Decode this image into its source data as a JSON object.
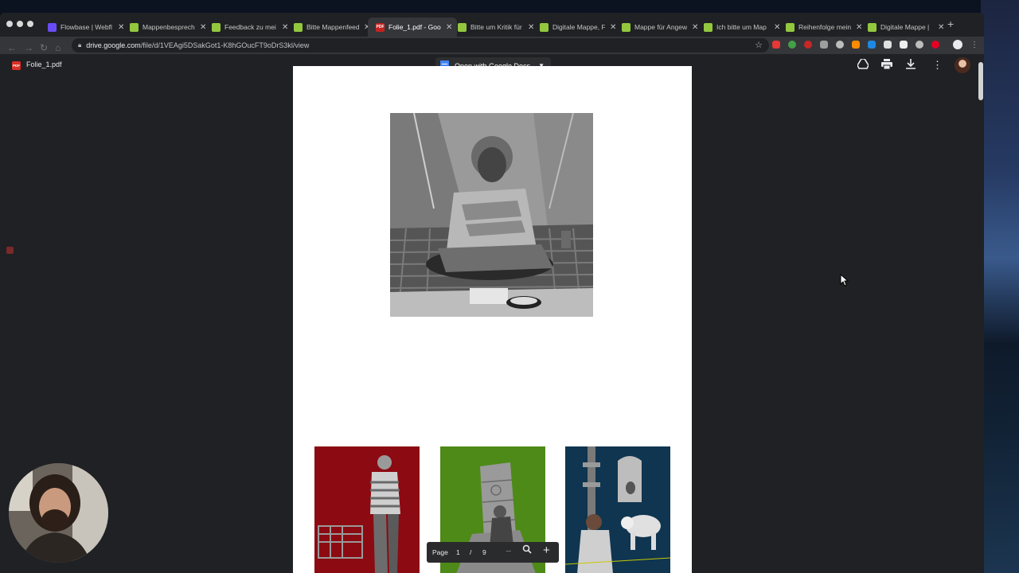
{
  "browser": {
    "tabs": [
      {
        "title": "Flowbase | Webfl",
        "favicon": "flowbase-icon",
        "active": false
      },
      {
        "title": "Mappenbesprech",
        "favicon": "shop-icon",
        "active": false
      },
      {
        "title": "Feedback zu mei",
        "favicon": "shop-icon",
        "active": false
      },
      {
        "title": "Bitte Mappenfeed",
        "favicon": "shop-icon",
        "active": false
      },
      {
        "title": "Folie_1.pdf - Goo",
        "favicon": "pdf-icon",
        "active": true
      },
      {
        "title": "Bitte um Kritik für",
        "favicon": "shop-icon",
        "active": false
      },
      {
        "title": "Digitale Mappe, F",
        "favicon": "shop-icon",
        "active": false
      },
      {
        "title": "Mappe für Angew",
        "favicon": "shop-icon",
        "active": false
      },
      {
        "title": "Ich bitte um Map",
        "favicon": "shop-icon",
        "active": false
      },
      {
        "title": "Reihenfolge mein",
        "favicon": "shop-icon",
        "active": false
      },
      {
        "title": "Digitale Mappe | ",
        "favicon": "shop-icon",
        "active": false
      }
    ],
    "url_host": "drive.google.com",
    "url_path": "/file/d/1VEAgi5DSakGot1-K8hGOucFT9oDrS3kl/view",
    "pdf_favicon_text": "PDF"
  },
  "drive": {
    "file_name": "Folie_1.pdf",
    "pdf_badge": "PDF",
    "open_with": "Open with Google Docs",
    "page_label": "Page",
    "current_page": "1",
    "page_sep": "/",
    "total_pages": "9"
  },
  "colors": {
    "thumb_red": "#8c0a12",
    "thumb_green": "#4e8a17",
    "thumb_blue": "#0f3550"
  }
}
